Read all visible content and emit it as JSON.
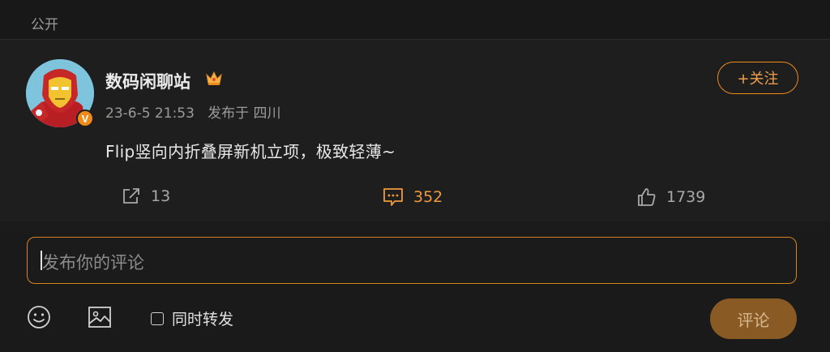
{
  "header": {
    "visibility": "公开"
  },
  "post": {
    "username": "数码闲聊站",
    "verified_mark": "V",
    "date": "23-6-5 21:53",
    "source": "发布于 四川",
    "follow_label": "+关注",
    "content": "Flip竖向内折叠屏新机立项，极致轻薄~",
    "actions": {
      "share_count": "13",
      "comment_count": "352",
      "like_count": "1739"
    }
  },
  "composer": {
    "placeholder": "发布你的评论",
    "repost_label": "同时转发",
    "submit_label": "评论"
  },
  "colors": {
    "accent": "#f08a1a",
    "submit_bg": "#8a5a24"
  }
}
